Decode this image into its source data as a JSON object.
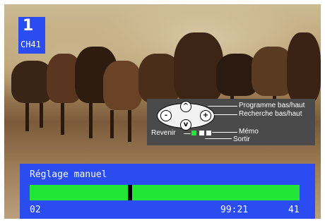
{
  "channel": {
    "number": "1",
    "name": "CH41"
  },
  "help": {
    "program": "Programme bas/haut",
    "search": "Recherche bas/haut",
    "back": "Revenir",
    "memo": "Mémo",
    "exit": "Sortir",
    "dpad_up": "^",
    "dpad_down": "v",
    "dpad_left": "-",
    "dpad_right": "+"
  },
  "tuning": {
    "title": "Réglage manuel",
    "fine_tune_level": 0.37,
    "left_value": "02",
    "frequency": "99:21",
    "right_value": "41"
  },
  "colors": {
    "panel_blue": "#2a4cf0",
    "bar_green": "#22e636",
    "help_bg": "#4a4a4a",
    "back_green": "#22e636"
  }
}
